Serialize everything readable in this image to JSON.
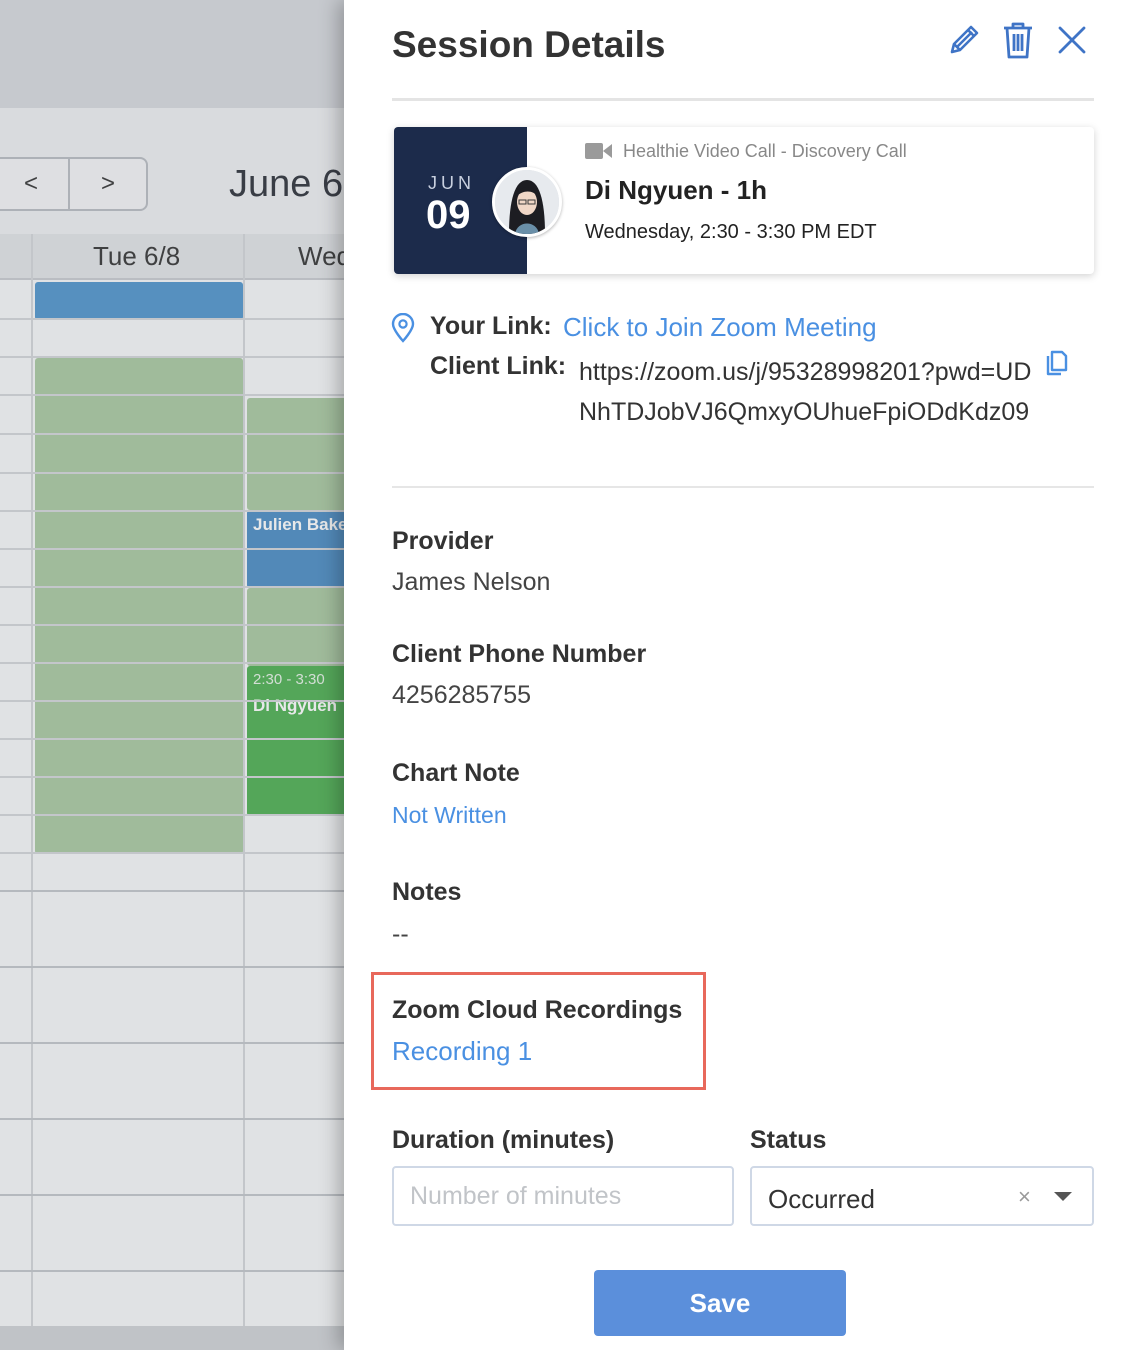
{
  "calendar": {
    "prev_label": "<",
    "next_label": ">",
    "month_label": "June 6",
    "day_headers": [
      "Tue 6/8",
      "Wed"
    ],
    "events": [
      {
        "name": "Julien Bake",
        "time": ""
      },
      {
        "name": "Di Ngyuen",
        "time": "2:30 - 3:30"
      }
    ]
  },
  "panel": {
    "title": "Session Details",
    "appointment": {
      "month": "JUN",
      "day": "09",
      "call_type": "Healthie Video Call - Discovery Call",
      "client_title": "Di Ngyuen - 1h",
      "time": "Wednesday, 2:30 - 3:30 PM EDT"
    },
    "links": {
      "your_label": "Your Link:",
      "your_value": "Click to Join Zoom Meeting",
      "client_label": "Client Link:",
      "client_value": "https://zoom.us/j/95328998201?pwd=UDNhTDJobVJ6QmxyOUhueFpiODdKdz09"
    },
    "provider": {
      "label": "Provider",
      "value": "James Nelson"
    },
    "phone": {
      "label": "Client Phone Number",
      "value": "4256285755"
    },
    "chart_note": {
      "label": "Chart Note",
      "value": "Not Written"
    },
    "notes": {
      "label": "Notes",
      "value": "--"
    },
    "recordings": {
      "label": "Zoom Cloud Recordings",
      "value": "Recording 1"
    },
    "duration": {
      "label": "Duration (minutes)",
      "placeholder": "Number of minutes"
    },
    "status": {
      "label": "Status",
      "value": "Occurred",
      "clear": "×"
    },
    "save_label": "Save"
  },
  "colors": {
    "accent": "#4a90e2",
    "navy": "#1c2b4b",
    "save": "#5b8fdb",
    "highlight": "#e8685b",
    "event_blue": "#4a8cc4",
    "event_green": "#4caf50"
  }
}
